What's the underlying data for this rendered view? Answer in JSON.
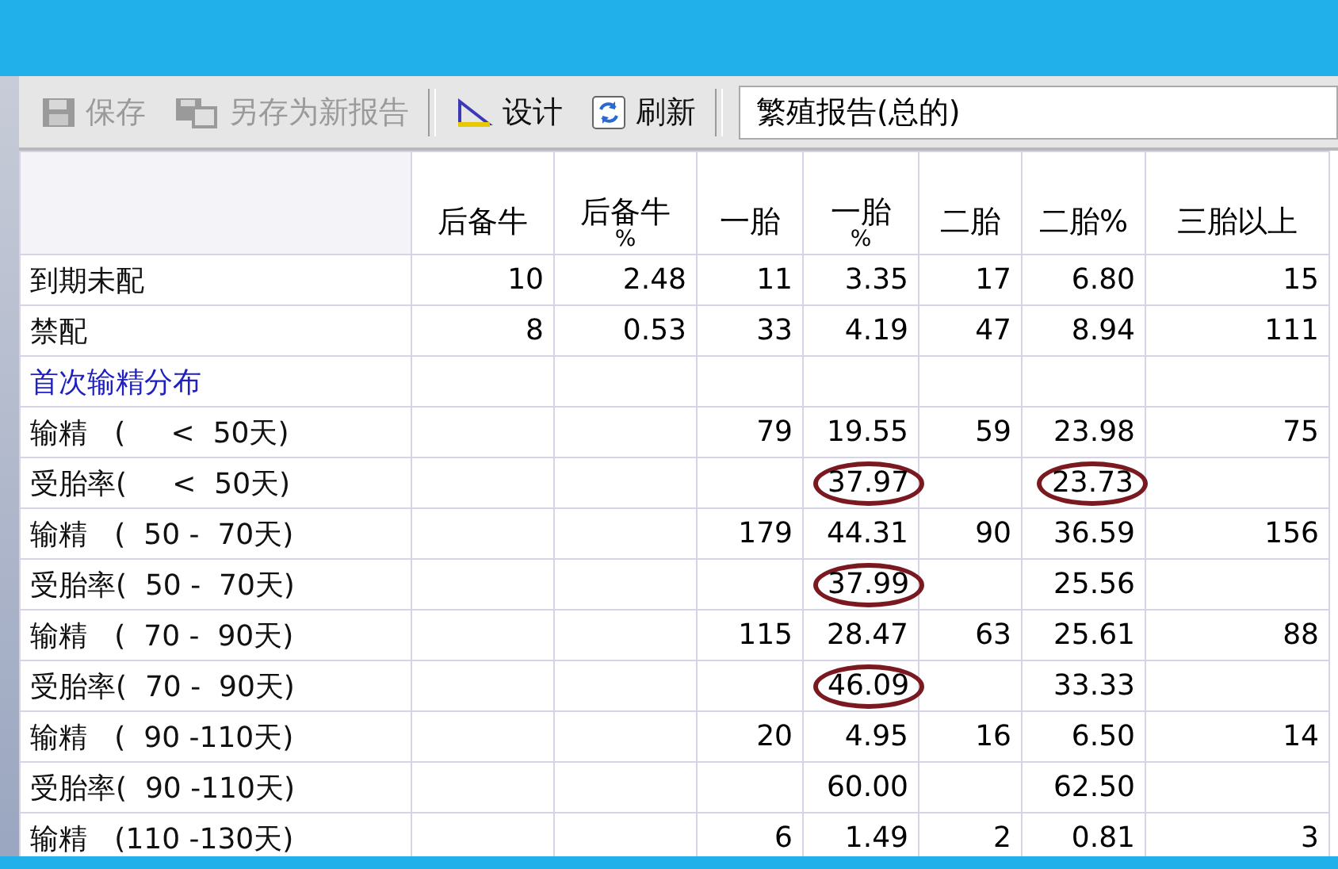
{
  "toolbar": {
    "buttons": [
      {
        "label": "保存",
        "kind": "save",
        "disabled": true
      },
      {
        "label": "另存为新报告",
        "kind": "saveas",
        "disabled": true
      },
      {
        "label": "设计",
        "kind": "design",
        "disabled": false
      },
      {
        "label": "刷新",
        "kind": "refresh",
        "disabled": false
      }
    ],
    "report_field": {
      "value": "繁殖报告(总的)"
    }
  },
  "table": {
    "columns": [
      {
        "label": "后备牛"
      },
      {
        "label": "后备牛",
        "sub": "%"
      },
      {
        "label": "一胎"
      },
      {
        "label": "一胎",
        "sub": "%"
      },
      {
        "label": "二胎"
      },
      {
        "label": "二胎%"
      },
      {
        "label": "三胎以上"
      }
    ],
    "rows": [
      {
        "kind": "data",
        "label": "到期未配",
        "cells": [
          {
            "text": "10",
            "circled": false
          },
          {
            "text": "2.48",
            "circled": false
          },
          {
            "text": "11",
            "circled": false
          },
          {
            "text": "3.35",
            "circled": false
          },
          {
            "text": "17",
            "circled": false
          },
          {
            "text": "6.80",
            "circled": false
          },
          {
            "text": "15",
            "circled": false
          }
        ]
      },
      {
        "kind": "data",
        "label": "禁配",
        "cells": [
          {
            "text": "8",
            "circled": false
          },
          {
            "text": "0.53",
            "circled": false
          },
          {
            "text": "33",
            "circled": false
          },
          {
            "text": "4.19",
            "circled": false
          },
          {
            "text": "47",
            "circled": false
          },
          {
            "text": "8.94",
            "circled": false
          },
          {
            "text": "111",
            "circled": false
          }
        ]
      },
      {
        "kind": "section",
        "label": "首次输精分布",
        "cells": [
          null,
          null,
          null,
          null,
          null,
          null,
          null
        ]
      },
      {
        "kind": "data",
        "label": "输精   (     <  50天)",
        "cells": [
          null,
          null,
          {
            "text": "79",
            "circled": false
          },
          {
            "text": "19.55",
            "circled": false
          },
          {
            "text": "59",
            "circled": false
          },
          {
            "text": "23.98",
            "circled": false
          },
          {
            "text": "75",
            "circled": false
          }
        ]
      },
      {
        "kind": "data",
        "label": "受胎率(     <  50天)",
        "cells": [
          null,
          null,
          null,
          {
            "text": "37.97",
            "circled": true
          },
          null,
          {
            "text": "23.73",
            "circled": true
          },
          null
        ]
      },
      {
        "kind": "data",
        "label": "输精   (  50 -  70天)",
        "cells": [
          null,
          null,
          {
            "text": "179",
            "circled": false
          },
          {
            "text": "44.31",
            "circled": false
          },
          {
            "text": "90",
            "circled": false
          },
          {
            "text": "36.59",
            "circled": false
          },
          {
            "text": "156",
            "circled": false
          }
        ]
      },
      {
        "kind": "data",
        "label": "受胎率(  50 -  70天)",
        "cells": [
          null,
          null,
          null,
          {
            "text": "37.99",
            "circled": true
          },
          null,
          {
            "text": "25.56",
            "circled": false
          },
          null
        ]
      },
      {
        "kind": "data",
        "label": "输精   (  70 -  90天)",
        "cells": [
          null,
          null,
          {
            "text": "115",
            "circled": false
          },
          {
            "text": "28.47",
            "circled": false
          },
          {
            "text": "63",
            "circled": false
          },
          {
            "text": "25.61",
            "circled": false
          },
          {
            "text": "88",
            "circled": false
          }
        ]
      },
      {
        "kind": "data",
        "label": "受胎率(  70 -  90天)",
        "cells": [
          null,
          null,
          null,
          {
            "text": "46.09",
            "circled": true
          },
          null,
          {
            "text": "33.33",
            "circled": false
          },
          null
        ]
      },
      {
        "kind": "data",
        "label": "输精   (  90 -110天)",
        "cells": [
          null,
          null,
          {
            "text": "20",
            "circled": false
          },
          {
            "text": "4.95",
            "circled": false
          },
          {
            "text": "16",
            "circled": false
          },
          {
            "text": "6.50",
            "circled": false
          },
          {
            "text": "14",
            "circled": false
          }
        ]
      },
      {
        "kind": "data",
        "label": "受胎率(  90 -110天)",
        "cells": [
          null,
          null,
          null,
          {
            "text": "60.00",
            "circled": false
          },
          null,
          {
            "text": "62.50",
            "circled": false
          },
          null
        ]
      },
      {
        "kind": "data",
        "label": "输精   (110 -130天)",
        "cells": [
          null,
          null,
          {
            "text": "6",
            "circled": false
          },
          {
            "text": "1.49",
            "circled": false
          },
          {
            "text": "2",
            "circled": false
          },
          {
            "text": "0.81",
            "circled": false
          },
          {
            "text": "3",
            "circled": false
          }
        ]
      }
    ]
  }
}
